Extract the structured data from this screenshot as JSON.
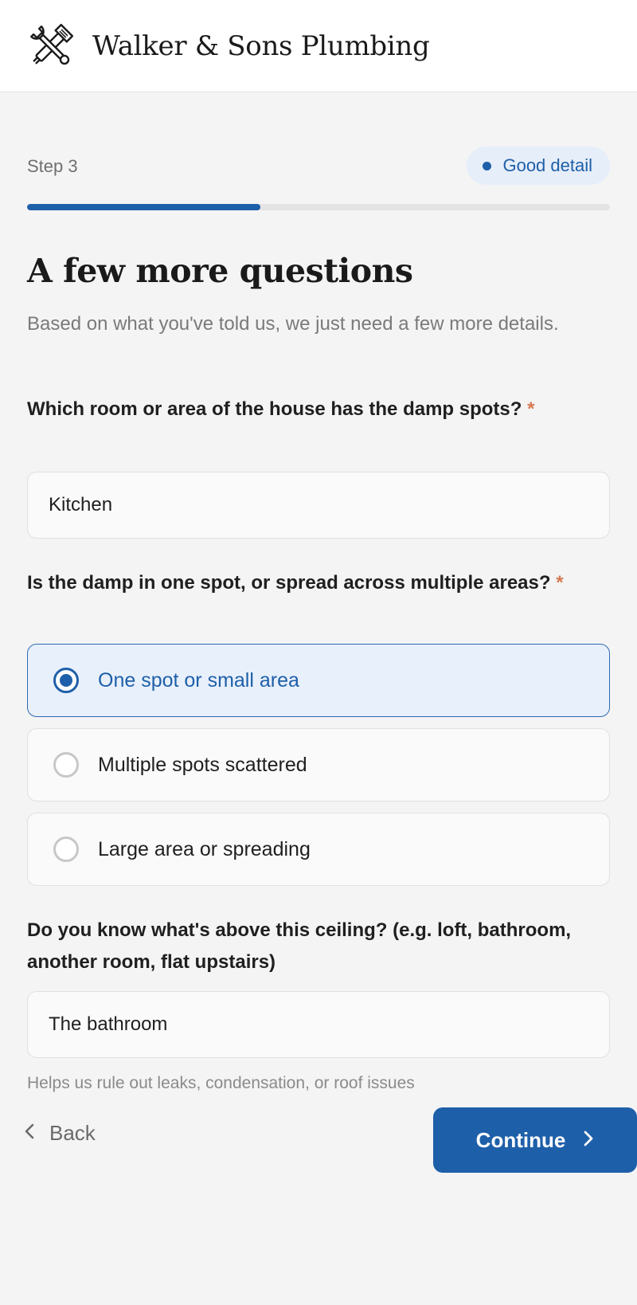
{
  "header": {
    "brand": "Walker & Sons Plumbing",
    "logo_icon": "wrench-and-pipe-wrench-icon"
  },
  "progress": {
    "step_label": "Step 3",
    "fraction": 0.4,
    "quality_badge": "Good detail"
  },
  "page": {
    "title": "A few more questions",
    "subtitle": "Based on what you've told us, we just need a few more details."
  },
  "questions": {
    "room": {
      "label": "Which room or area of the house has the damp spots?",
      "required_marker": "*",
      "value": "Kitchen"
    },
    "spread": {
      "label": "Is the damp in one spot, or spread across multiple areas?",
      "required_marker": "*",
      "options": [
        {
          "label": "One spot or small area",
          "selected": true
        },
        {
          "label": "Multiple spots scattered",
          "selected": false
        },
        {
          "label": "Large area or spreading",
          "selected": false
        }
      ]
    },
    "above": {
      "label": "Do you know what's above this ceiling? (e.g. loft, bathroom, another room, flat upstairs)",
      "value": "The bathroom",
      "helper": "Helps us rule out leaks, condensation, or roof issues"
    }
  },
  "footer": {
    "back_label": "Back",
    "continue_label": "Continue"
  },
  "colors": {
    "accent": "#1e5fa9",
    "selected_bg": "#e8f0fb",
    "required": "#d77a52",
    "background": "#f4f4f4"
  }
}
